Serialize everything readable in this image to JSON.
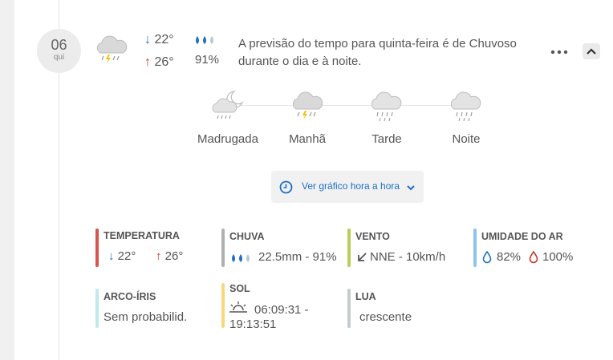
{
  "day": {
    "date": "06",
    "weekday": "qui",
    "min_temp": "22°",
    "max_temp": "26°",
    "rain_probability": "91%",
    "summary": "A previsão do tempo para quinta-feira é de Chuvoso durante o dia e à noite.",
    "condition_icon": "rain-thunder-cloud-icon"
  },
  "periods": [
    {
      "label": "Madrugada",
      "icon": "moon-cloud-rain-icon"
    },
    {
      "label": "Manhã",
      "icon": "rain-thunder-cloud-icon"
    },
    {
      "label": "Tarde",
      "icon": "rain-cloud-icon"
    },
    {
      "label": "Noite",
      "icon": "rain-cloud-icon"
    }
  ],
  "chart_button": {
    "label": "Ver gráfico hora a hora"
  },
  "stats": {
    "temperature": {
      "title": "TEMPERATURA",
      "min": "22°",
      "max": "26°",
      "color": "#d9534f"
    },
    "rain": {
      "title": "CHUVA",
      "value": "22.5mm - 91%",
      "color": "#b0b0b0"
    },
    "wind": {
      "title": "VENTO",
      "value": "NNE - 10km/h",
      "color": "#b5cf56"
    },
    "humidity": {
      "title": "UMIDADE DO AR",
      "min": "82%",
      "max": "100%",
      "color": "#8ec4ec"
    },
    "rainbow": {
      "title": "ARCO-ÍRIS",
      "value": "Sem probabilid.",
      "color": "#bfe9ec"
    },
    "sun": {
      "title": "SOL",
      "sunrise": "06:09:31 -",
      "sunset": "19:13:51",
      "color": "#f5d97a"
    },
    "moon": {
      "title": "LUA",
      "value": "crescente",
      "color": "#c5cbd0"
    }
  },
  "colors": {
    "accent_blue": "#1e6fc5",
    "up_red": "#d32f2f",
    "thunder_yellow": "#f2c200"
  }
}
